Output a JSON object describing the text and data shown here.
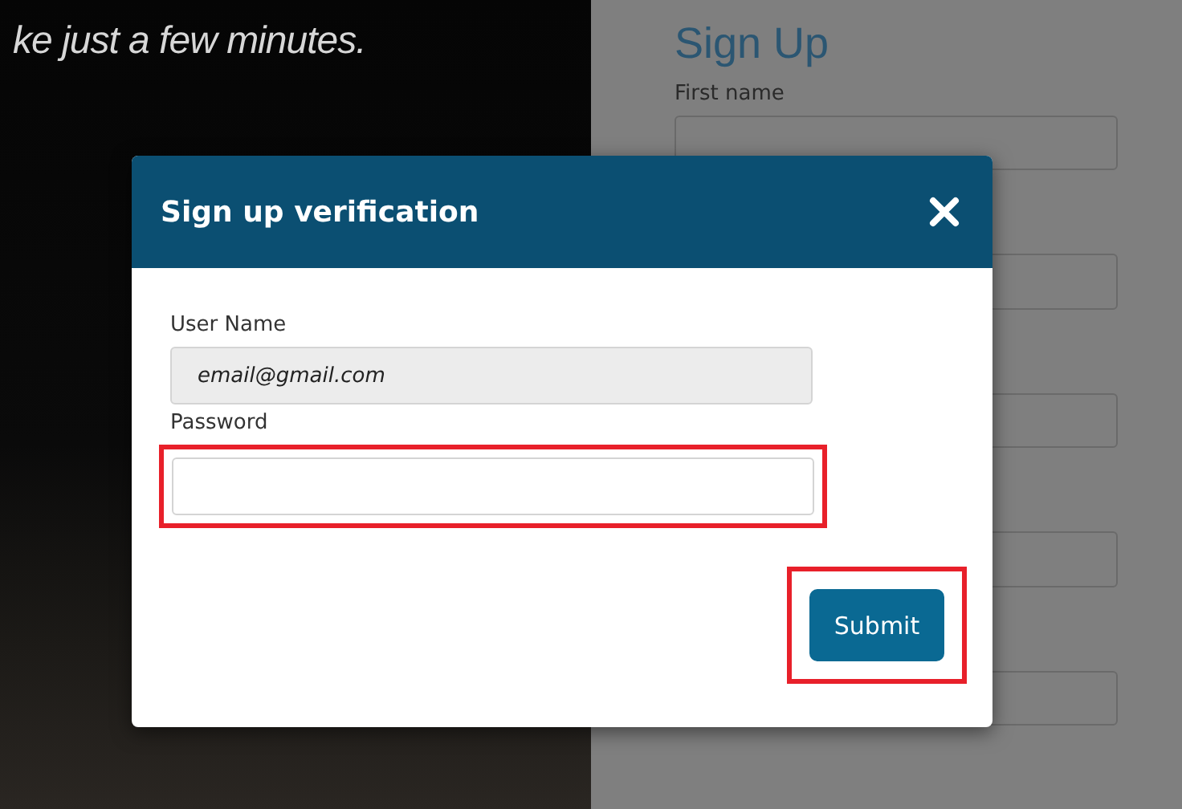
{
  "background": {
    "headline": "ke just a few minutes.",
    "form": {
      "title": "Sign Up",
      "first_label": "First name"
    }
  },
  "dialog": {
    "title": "Sign up verification",
    "fields": [
      {
        "label": "User Name",
        "value": "email@gmail.com",
        "readonly": true,
        "highlighted": false
      },
      {
        "label": "Password",
        "readonly": false,
        "highlighted": true
      }
    ],
    "submit": {
      "label": "Submit",
      "highlighted": true
    }
  }
}
